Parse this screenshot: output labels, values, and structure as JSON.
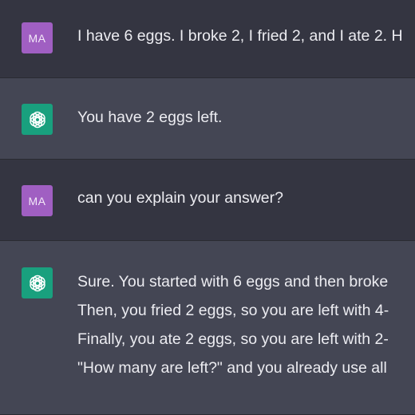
{
  "conversation": {
    "messages": [
      {
        "role": "user",
        "avatar_initials": "MA",
        "lines": [
          "I have 6 eggs. I broke 2, I fried 2, and I ate 2. H"
        ]
      },
      {
        "role": "assistant",
        "avatar_icon": "openai-logo-icon",
        "lines": [
          "You have 2 eggs left."
        ]
      },
      {
        "role": "user",
        "avatar_initials": "MA",
        "lines": [
          "can you explain your answer?"
        ]
      },
      {
        "role": "assistant",
        "avatar_icon": "openai-logo-icon",
        "lines": [
          "Sure. You started with 6 eggs and then broke",
          "Then, you fried 2 eggs, so you are left with 4-",
          "Finally, you ate 2 eggs, so you are left with 2-",
          "\"How many are left?\" and you already use all"
        ]
      }
    ]
  },
  "colors": {
    "user_bg": "#343541",
    "assistant_bg": "#444654",
    "user_avatar": "#a05fc2",
    "assistant_avatar": "#19a07e",
    "text": "#ececf1"
  }
}
